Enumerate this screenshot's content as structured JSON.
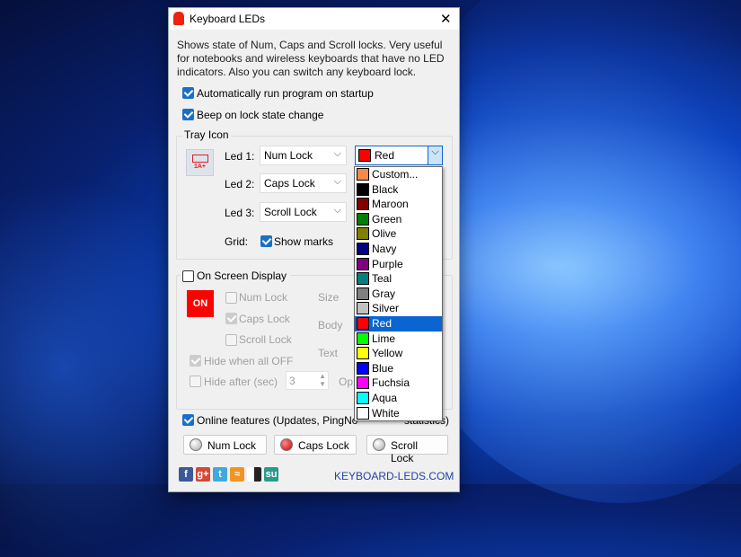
{
  "window": {
    "title": "Keyboard LEDs",
    "close": "✕"
  },
  "description": "Shows state of Num, Caps and Scroll locks. Very useful for notebooks and wireless keyboards that have no LED indicators. Also you can switch any keyboard lock.",
  "options": {
    "autorun": {
      "label": "Automatically run program on startup",
      "checked": true
    },
    "beep": {
      "label": "Beep on lock state change",
      "checked": true
    }
  },
  "tray": {
    "title": "Tray Icon",
    "led1_label": "Led 1:",
    "led1": "Num Lock",
    "led2_label": "Led 2:",
    "led2": "Caps Lock",
    "led3_label": "Led 3:",
    "led3": "Scroll Lock",
    "color": "Red",
    "color_hex": "#ff0000",
    "grid_label": "Grid:",
    "show_marks": "Show marks",
    "icon_text": "1A+"
  },
  "osd": {
    "title": "On Screen Display",
    "checked": false,
    "badge": "ON",
    "num": "Num Lock",
    "caps": "Caps Lock",
    "scroll": "Scroll Lock",
    "size": "Size",
    "body": "Body",
    "text": "Text",
    "hide_all_off": "Hide when all OFF",
    "hide_after": "Hide after (sec)",
    "hide_after_value": "3",
    "opacity": "Op"
  },
  "colors": [
    {
      "name": "Custom...",
      "hex": "#f58a4a"
    },
    {
      "name": "Black",
      "hex": "#000000"
    },
    {
      "name": "Maroon",
      "hex": "#800000"
    },
    {
      "name": "Green",
      "hex": "#008000"
    },
    {
      "name": "Olive",
      "hex": "#808000"
    },
    {
      "name": "Navy",
      "hex": "#000080"
    },
    {
      "name": "Purple",
      "hex": "#800080"
    },
    {
      "name": "Teal",
      "hex": "#008080"
    },
    {
      "name": "Gray",
      "hex": "#808080"
    },
    {
      "name": "Silver",
      "hex": "#c0c0c0"
    },
    {
      "name": "Red",
      "hex": "#ff0000",
      "selected": true
    },
    {
      "name": "Lime",
      "hex": "#00ff00"
    },
    {
      "name": "Yellow",
      "hex": "#ffff00"
    },
    {
      "name": "Blue",
      "hex": "#0000ff"
    },
    {
      "name": "Fuchsia",
      "hex": "#ff00ff"
    },
    {
      "name": "Aqua",
      "hex": "#00ffff"
    },
    {
      "name": "White",
      "hex": "#ffffff"
    }
  ],
  "online": {
    "label": "Online features (Updates, PingNo",
    "label_end": "statistics)",
    "checked": true
  },
  "buttons": {
    "num": "Num Lock",
    "caps": "Caps Lock",
    "scroll": "Scroll Lock"
  },
  "footer": {
    "link": "KEYBOARD-LEDS.COM",
    "social": [
      "facebook",
      "google-plus",
      "twitter",
      "rss",
      "delicious",
      "stumbleupon"
    ]
  }
}
